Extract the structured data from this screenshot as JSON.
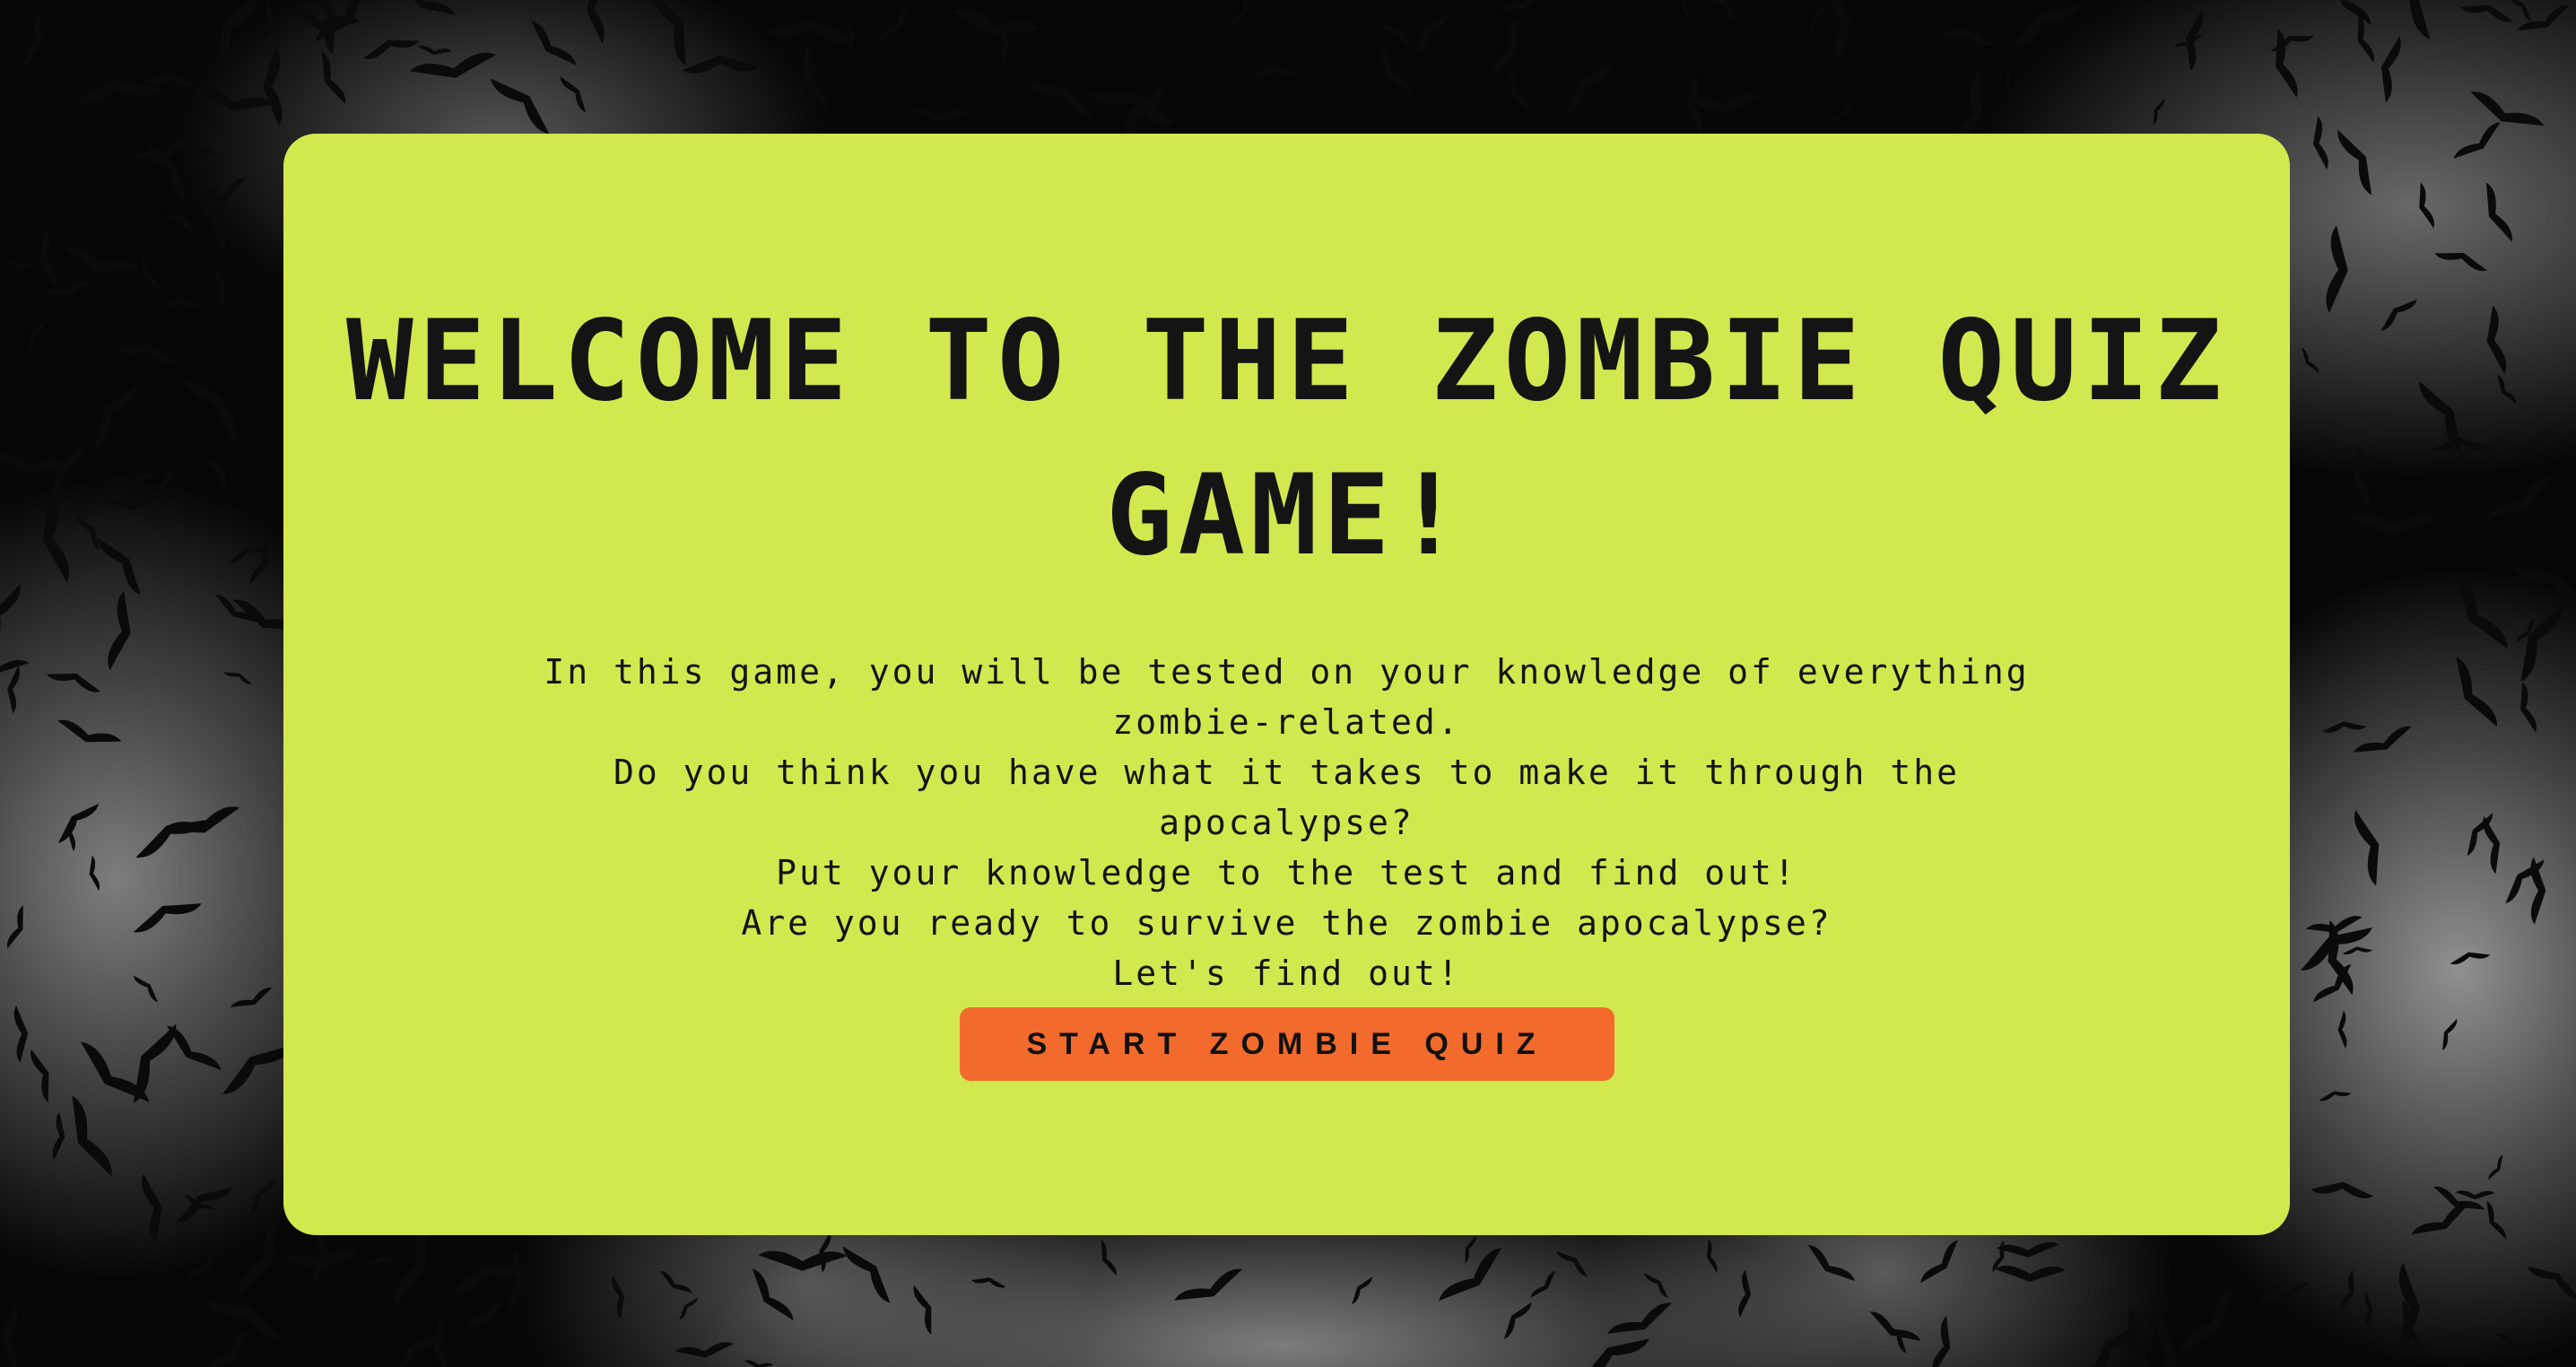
{
  "quiz": {
    "title": "WELCOME TO THE ZOMBIE QUIZ GAME!",
    "intro_lines": [
      "In this game, you will be tested on your knowledge of everything zombie-related.",
      "Do you think you have what it takes to make it through the apocalypse?",
      "Put your knowledge to the test and find out!",
      "Are you ready to survive the zombie apocalypse?",
      "Let's find out!"
    ],
    "start_button": "START ZOMBIE QUIZ"
  },
  "colors": {
    "card": "#d2e84f",
    "button": "#f26b2c",
    "text": "#141414",
    "background": "#060606"
  }
}
